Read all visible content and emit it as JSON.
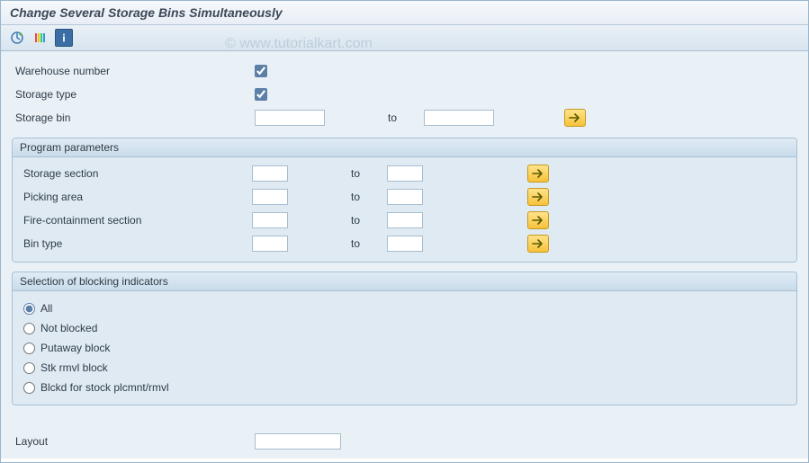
{
  "title": "Change Several Storage Bins Simultaneously",
  "watermark": "© www.tutorialkart.com",
  "toolbar": {
    "execute_icon": "execute",
    "colors_icon": "colors",
    "info_icon": "info"
  },
  "top_fields": {
    "warehouse_number_label": "Warehouse number",
    "warehouse_number_checked": true,
    "storage_type_label": "Storage type",
    "storage_type_checked": true,
    "storage_bin_label": "Storage bin",
    "to_label": "to"
  },
  "group_params": {
    "title": "Program parameters",
    "to_label": "to",
    "rows": [
      {
        "label": "Storage section"
      },
      {
        "label": "Picking area"
      },
      {
        "label": "Fire-containment section"
      },
      {
        "label": "Bin type"
      }
    ]
  },
  "group_blocking": {
    "title": "Selection of blocking indicators",
    "options": [
      {
        "label": "All",
        "checked": true
      },
      {
        "label": "Not blocked",
        "checked": false
      },
      {
        "label": "Putaway block",
        "checked": false
      },
      {
        "label": "Stk rmvl block",
        "checked": false
      },
      {
        "label": "Blckd for stock plcmnt/rmvl",
        "checked": false
      }
    ]
  },
  "layout": {
    "label": "Layout"
  }
}
